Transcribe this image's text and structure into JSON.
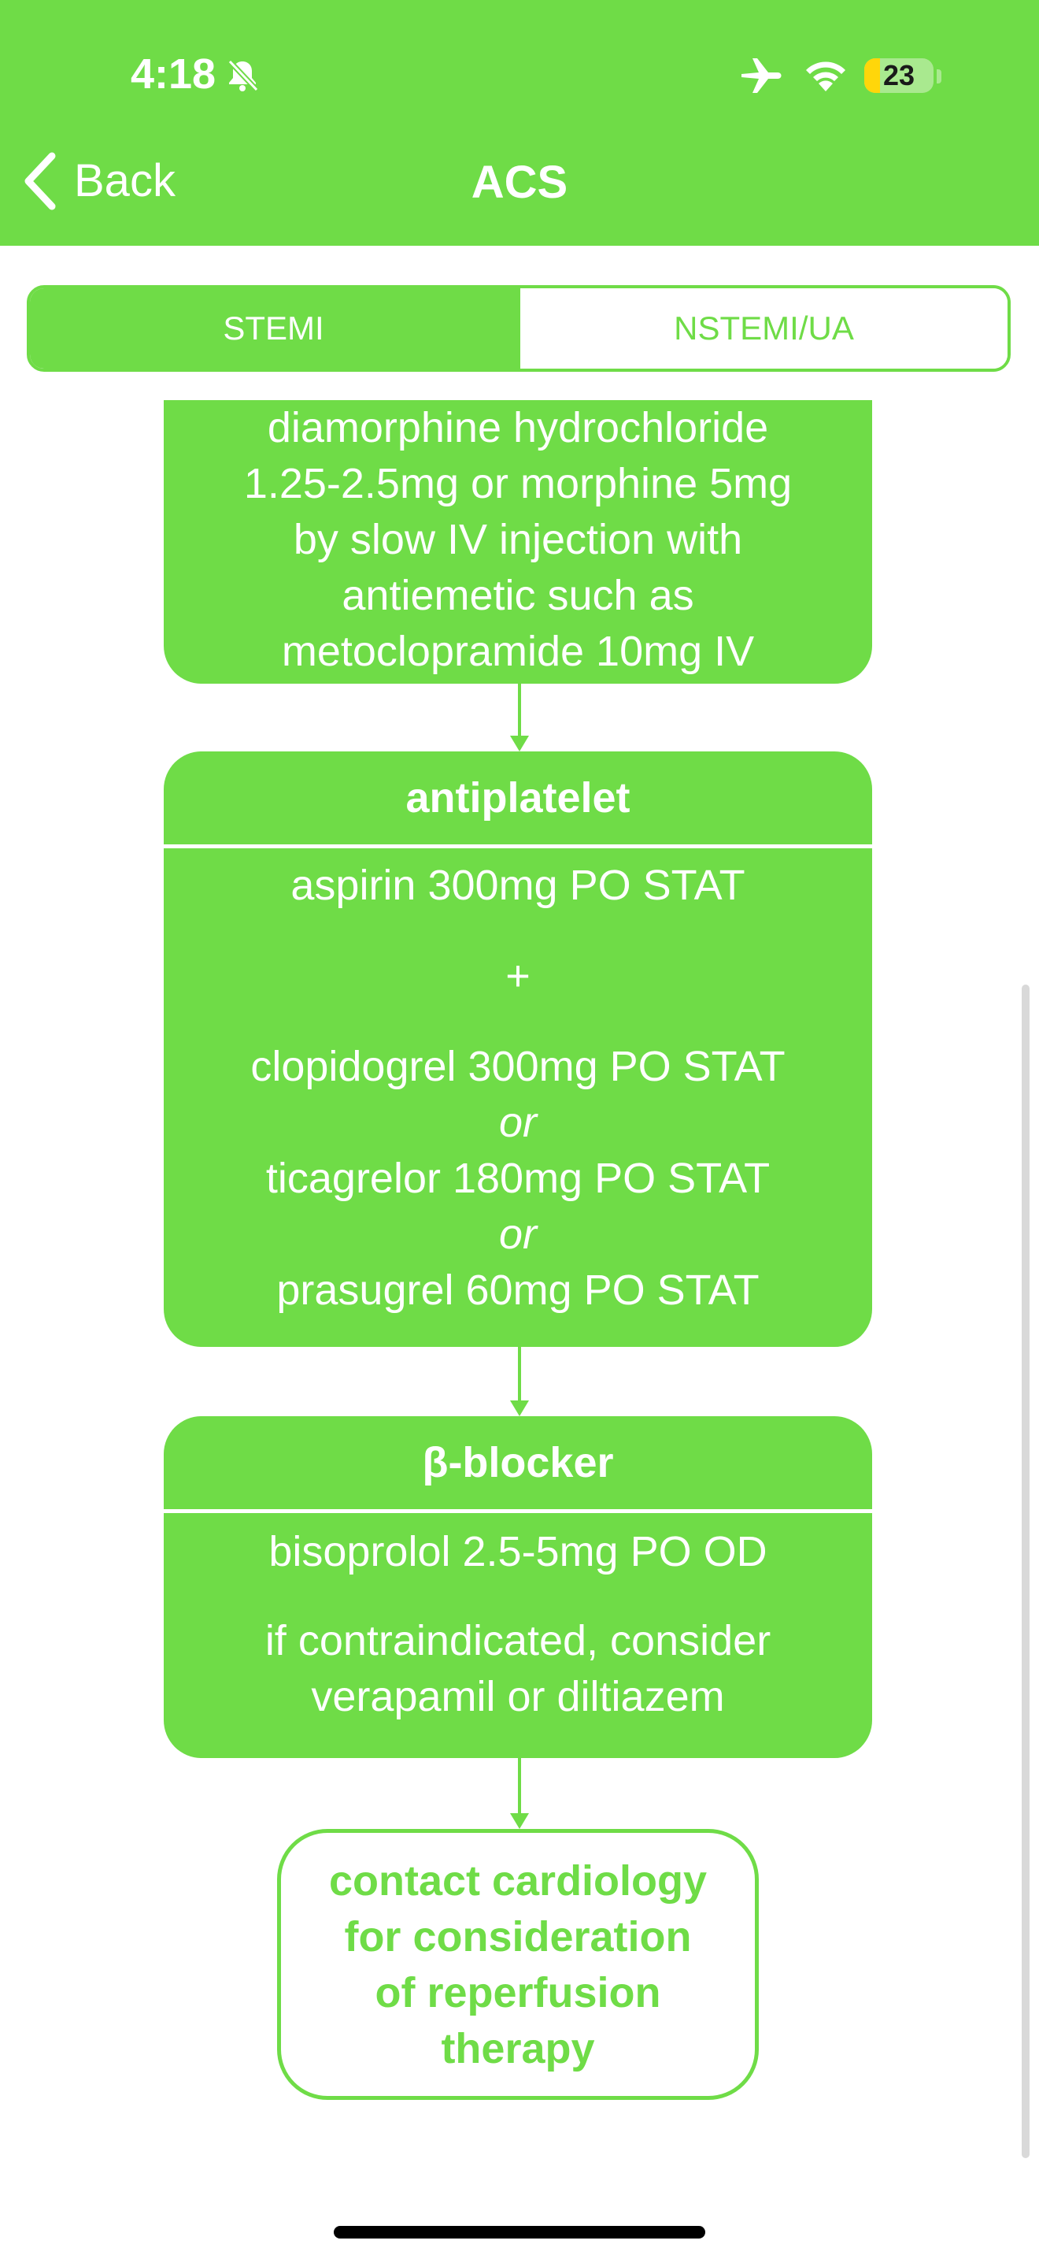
{
  "status_bar": {
    "time": "4:18",
    "battery_level": "23",
    "battery_fraction": 0.23,
    "icons": [
      "bell-slash-icon",
      "airplane-icon",
      "wifi-icon",
      "battery-icon"
    ]
  },
  "nav": {
    "back_label": "Back",
    "title": "ACS"
  },
  "segments": [
    {
      "label": "STEMI",
      "selected": true
    },
    {
      "label": "NSTEMI/UA",
      "selected": false
    }
  ],
  "flow": {
    "analgesia": {
      "lines": [
        "diamorphine hydrochloride",
        "1.25-2.5mg or morphine 5mg",
        "by slow IV injection with",
        "antiemetic such as",
        "metoclopramide 10mg IV"
      ]
    },
    "antiplatelet": {
      "title": "antiplatelet",
      "line1": "aspirin 300mg PO STAT",
      "plus": "+",
      "line2": "clopidogrel 300mg PO STAT",
      "or1": "or",
      "line3": "ticagrelor 180mg PO STAT",
      "or2": "or",
      "line4": "prasugrel 60mg PO STAT"
    },
    "beta_blocker": {
      "title": "β-blocker",
      "line1": "bisoprolol 2.5-5mg PO OD",
      "line2": "if contraindicated, consider",
      "line3": "verapamil or diltiazem"
    },
    "final": {
      "lines": [
        "contact cardiology",
        "for consideration",
        "of reperfusion",
        "therapy"
      ]
    }
  },
  "colors": {
    "accent": "#6fdc47",
    "text_on_accent": "#ffffff"
  }
}
